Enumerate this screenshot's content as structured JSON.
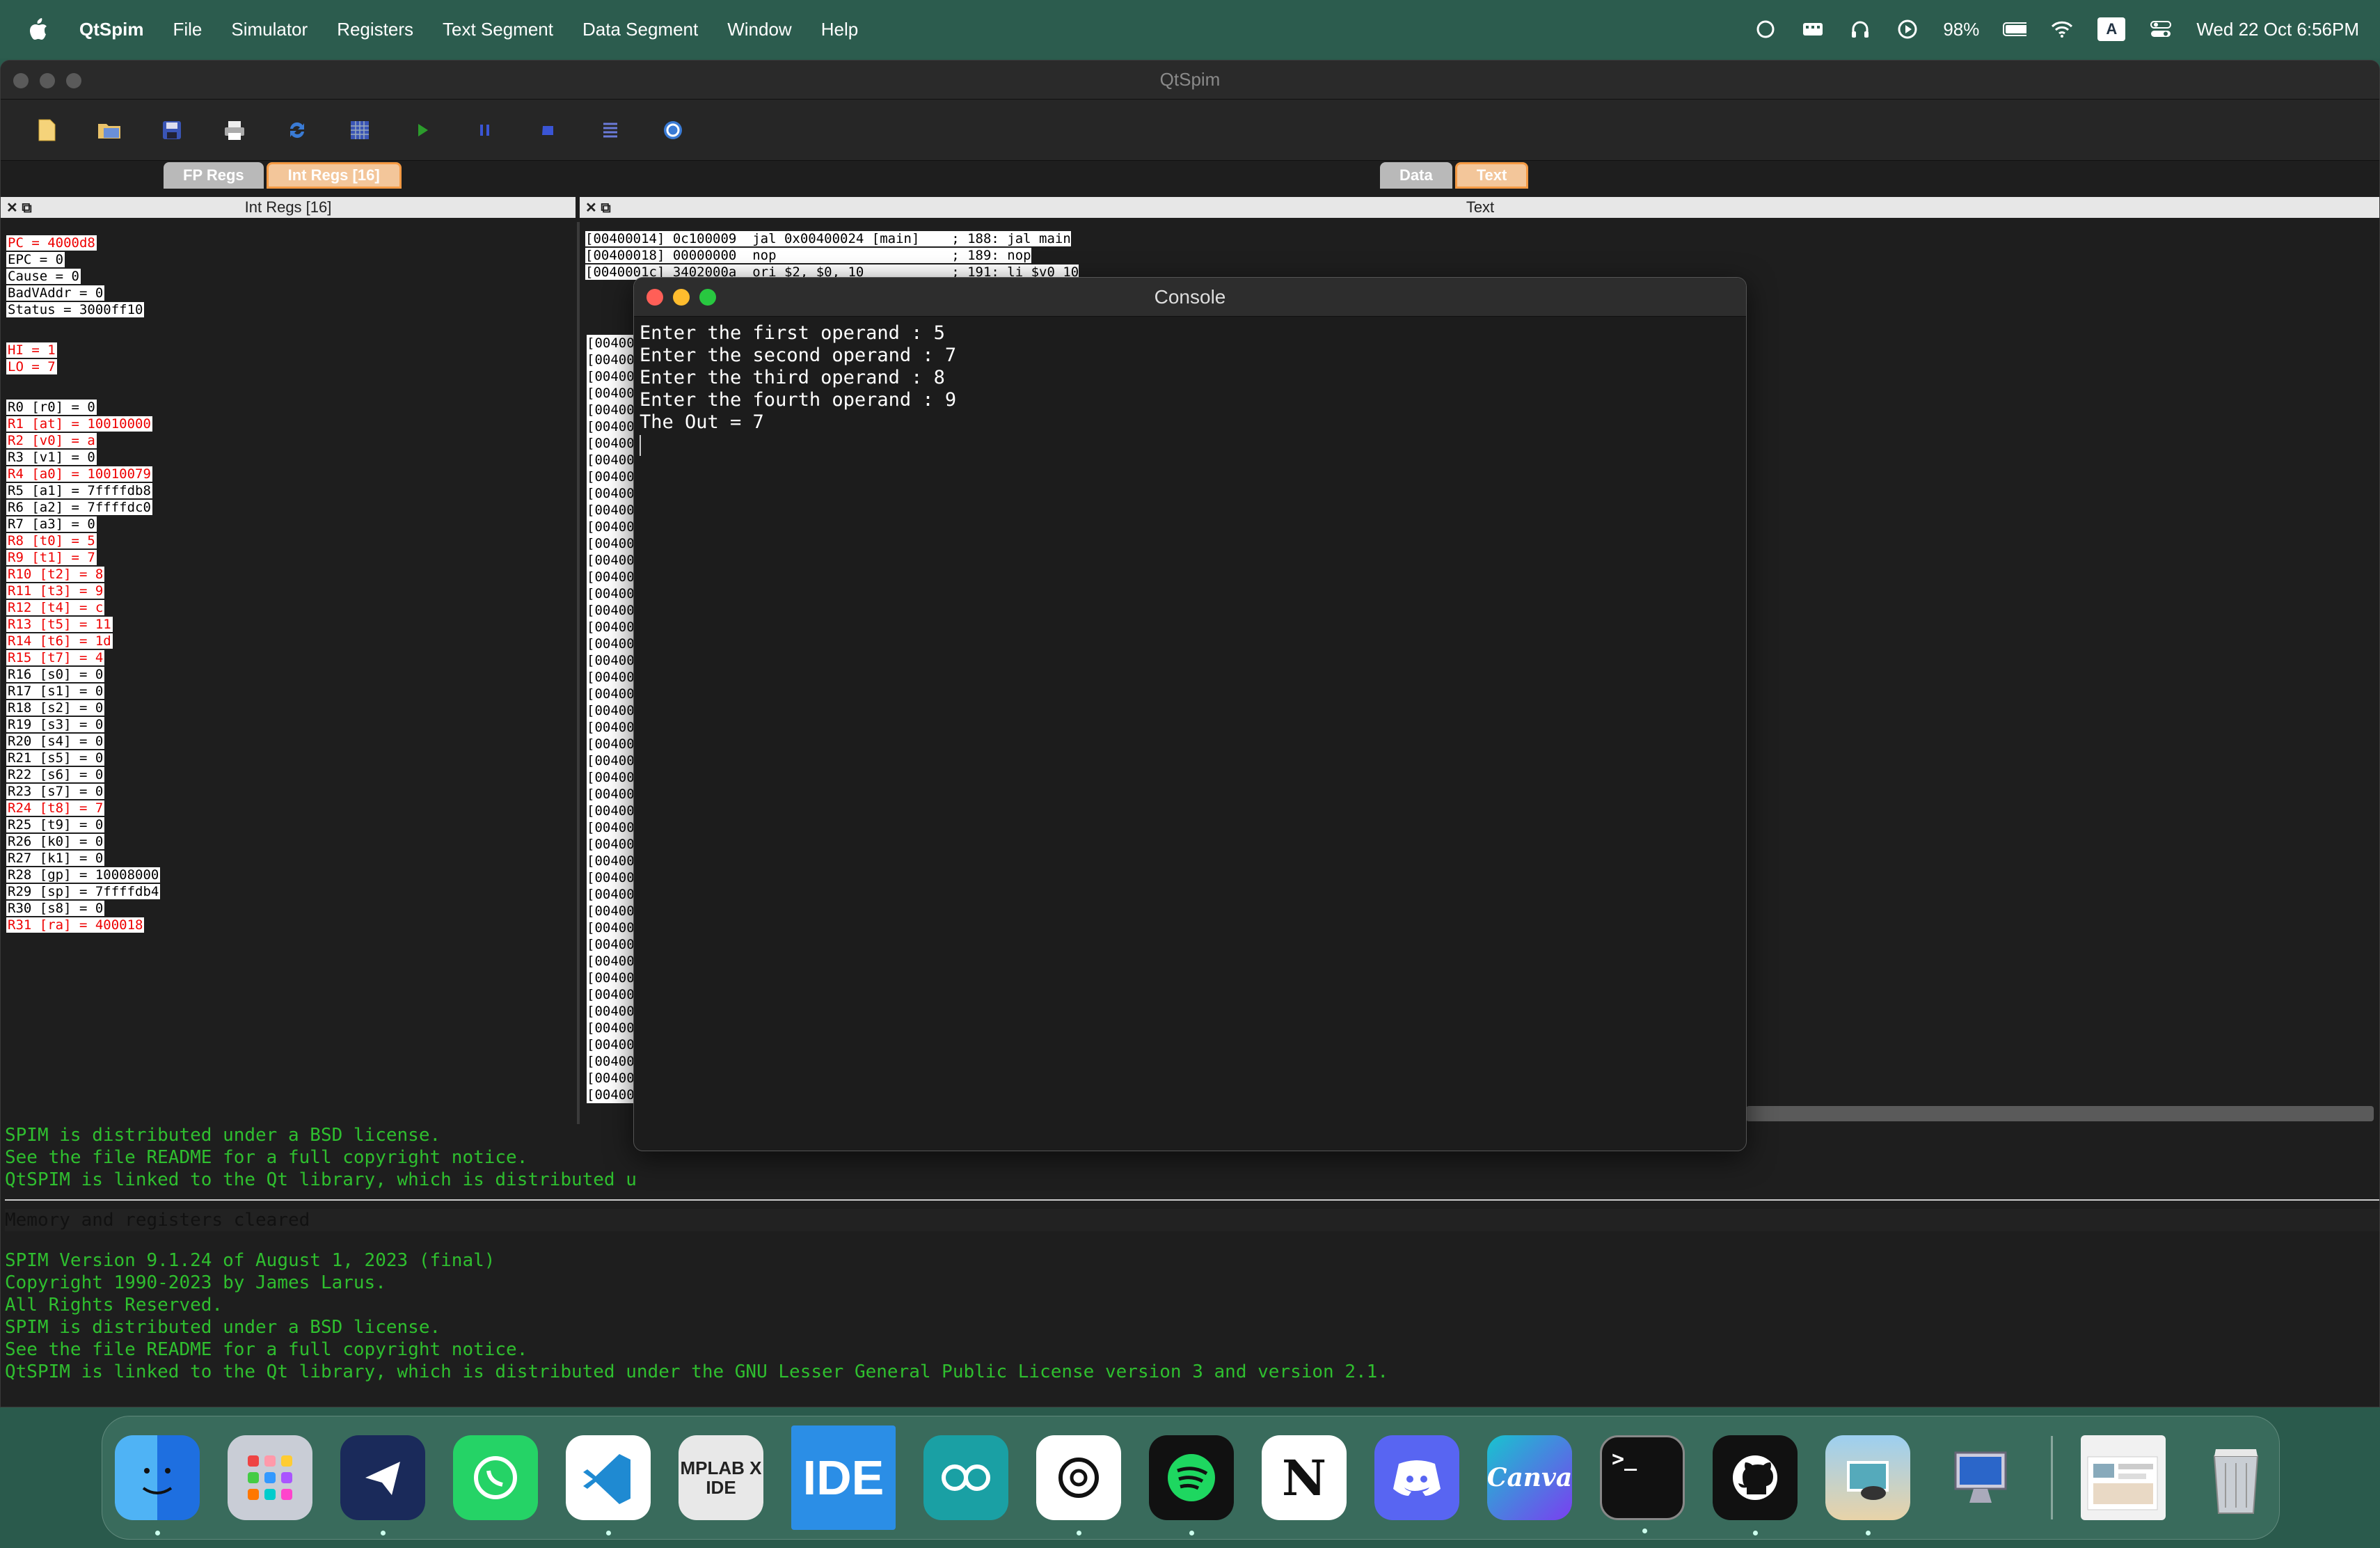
{
  "menubar": {
    "app": "QtSpim",
    "items": [
      "File",
      "Simulator",
      "Registers",
      "Text Segment",
      "Data Segment",
      "Window",
      "Help"
    ],
    "battery": "98%",
    "datetime": "Wed 22 Oct  6:56PM",
    "input_source": "A"
  },
  "window": {
    "title": "QtSpim"
  },
  "toolbar": {
    "icons": [
      "open-icon",
      "reload-icon",
      "save-icon",
      "print-icon",
      "refresh-icon",
      "grid-icon",
      "run-icon",
      "pause-icon",
      "stop-icon",
      "step-icon",
      "help-icon"
    ]
  },
  "left_tabs": {
    "fp": "FP Regs",
    "int": "Int Regs [16]"
  },
  "right_tabs": {
    "data": "Data",
    "text": "Text"
  },
  "left_pane": {
    "title": "Int Regs [16]"
  },
  "right_pane": {
    "title": "Text"
  },
  "special_regs": [
    {
      "text": "PC       = 4000d8",
      "changed": true
    },
    {
      "text": "EPC      = 0",
      "changed": false
    },
    {
      "text": "Cause    = 0",
      "changed": false
    },
    {
      "text": "BadVAddr = 0",
      "changed": false
    },
    {
      "text": "Status   = 3000ff10",
      "changed": false
    }
  ],
  "hilo": [
    {
      "text": "HI       = 1",
      "changed": true
    },
    {
      "text": "LO       = 7",
      "changed": true
    }
  ],
  "gprs": [
    {
      "text": "R0  [r0] = 0",
      "changed": false
    },
    {
      "text": "R1  [at] = 10010000",
      "changed": true
    },
    {
      "text": "R2  [v0] = a",
      "changed": true
    },
    {
      "text": "R3  [v1] = 0",
      "changed": false
    },
    {
      "text": "R4  [a0] = 10010079",
      "changed": true
    },
    {
      "text": "R5  [a1] = 7ffffdb8",
      "changed": false
    },
    {
      "text": "R6  [a2] = 7ffffdc0",
      "changed": false
    },
    {
      "text": "R7  [a3] = 0",
      "changed": false
    },
    {
      "text": "R8  [t0] = 5",
      "changed": true
    },
    {
      "text": "R9  [t1] = 7",
      "changed": true
    },
    {
      "text": "R10 [t2] = 8",
      "changed": true
    },
    {
      "text": "R11 [t3] = 9",
      "changed": true
    },
    {
      "text": "R12 [t4] = c",
      "changed": true
    },
    {
      "text": "R13 [t5] = 11",
      "changed": true
    },
    {
      "text": "R14 [t6] = 1d",
      "changed": true
    },
    {
      "text": "R15 [t7] = 4",
      "changed": true
    },
    {
      "text": "R16 [s0] = 0",
      "changed": false
    },
    {
      "text": "R17 [s1] = 0",
      "changed": false
    },
    {
      "text": "R18 [s2] = 0",
      "changed": false
    },
    {
      "text": "R19 [s3] = 0",
      "changed": false
    },
    {
      "text": "R20 [s4] = 0",
      "changed": false
    },
    {
      "text": "R21 [s5] = 0",
      "changed": false
    },
    {
      "text": "R22 [s6] = 0",
      "changed": false
    },
    {
      "text": "R23 [s7] = 0",
      "changed": false
    },
    {
      "text": "R24 [t8] = 7",
      "changed": true
    },
    {
      "text": "R25 [t9] = 0",
      "changed": false
    },
    {
      "text": "R26 [k0] = 0",
      "changed": false
    },
    {
      "text": "R27 [k1] = 0",
      "changed": false
    },
    {
      "text": "R28 [gp] = 10008000",
      "changed": false
    },
    {
      "text": "R29 [sp] = 7ffffdb4",
      "changed": false
    },
    {
      "text": "R30 [s8] = 0",
      "changed": false
    },
    {
      "text": "R31 [ra] = 400018",
      "changed": true
    }
  ],
  "text_lines": [
    "[00400014] 0c100009  jal 0x00400024 [main]    ; 188: jal main",
    "[00400018] 00000000  nop                      ; 189: nop",
    "[0040001c] 3402000a  ori $2, $0, 10           ; 191: li $v0 10"
  ],
  "text_stub": "[00400",
  "console": {
    "title": "Console",
    "lines": [
      "Enter the first operand : 5",
      "Enter the second operand : 7",
      "Enter the third operand : 8",
      "Enter the fourth operand : 9",
      "The Out = 7"
    ]
  },
  "log": {
    "upper": [
      "SPIM is distributed under a BSD license.",
      "See the file README for a full copyright notice.",
      "QtSPIM is linked to the Qt library, which is distributed u"
    ],
    "cleared": "Memory and registers cleared",
    "lower": [
      "SPIM Version 9.1.24 of August 1, 2023 (final)",
      "Copyright 1990-2023 by James Larus.",
      "All Rights Reserved.",
      "SPIM is distributed under a BSD license.",
      "See the file README for a full copyright notice.",
      "QtSPIM is linked to the Qt library, which is distributed under the GNU Lesser General Public License version 3 and version 2.1."
    ]
  },
  "dock": {
    "apps": [
      "Finder",
      "Launchpad",
      "Spark",
      "WhatsApp",
      "VS Code",
      "MPLAB X IDE",
      "IDE",
      "Arduino",
      "ChatGPT",
      "Spotify",
      "Notion",
      "Discord",
      "Canva",
      "Terminal",
      "GitHub",
      "Preview",
      "Remote Desktop",
      "Downloads",
      "Trash"
    ],
    "labels": {
      "mplab": "MPLAB X IDE",
      "ide": "IDE",
      "canva": "Canva",
      "notion": "N",
      "terminal": ">_"
    }
  },
  "colors": {
    "changed_register": "#ff0000",
    "console_bg": "#1c1c1c",
    "log_green": "#2fbf2f",
    "active_tab": "#f49a44",
    "desktop": "#2a5a4c"
  }
}
